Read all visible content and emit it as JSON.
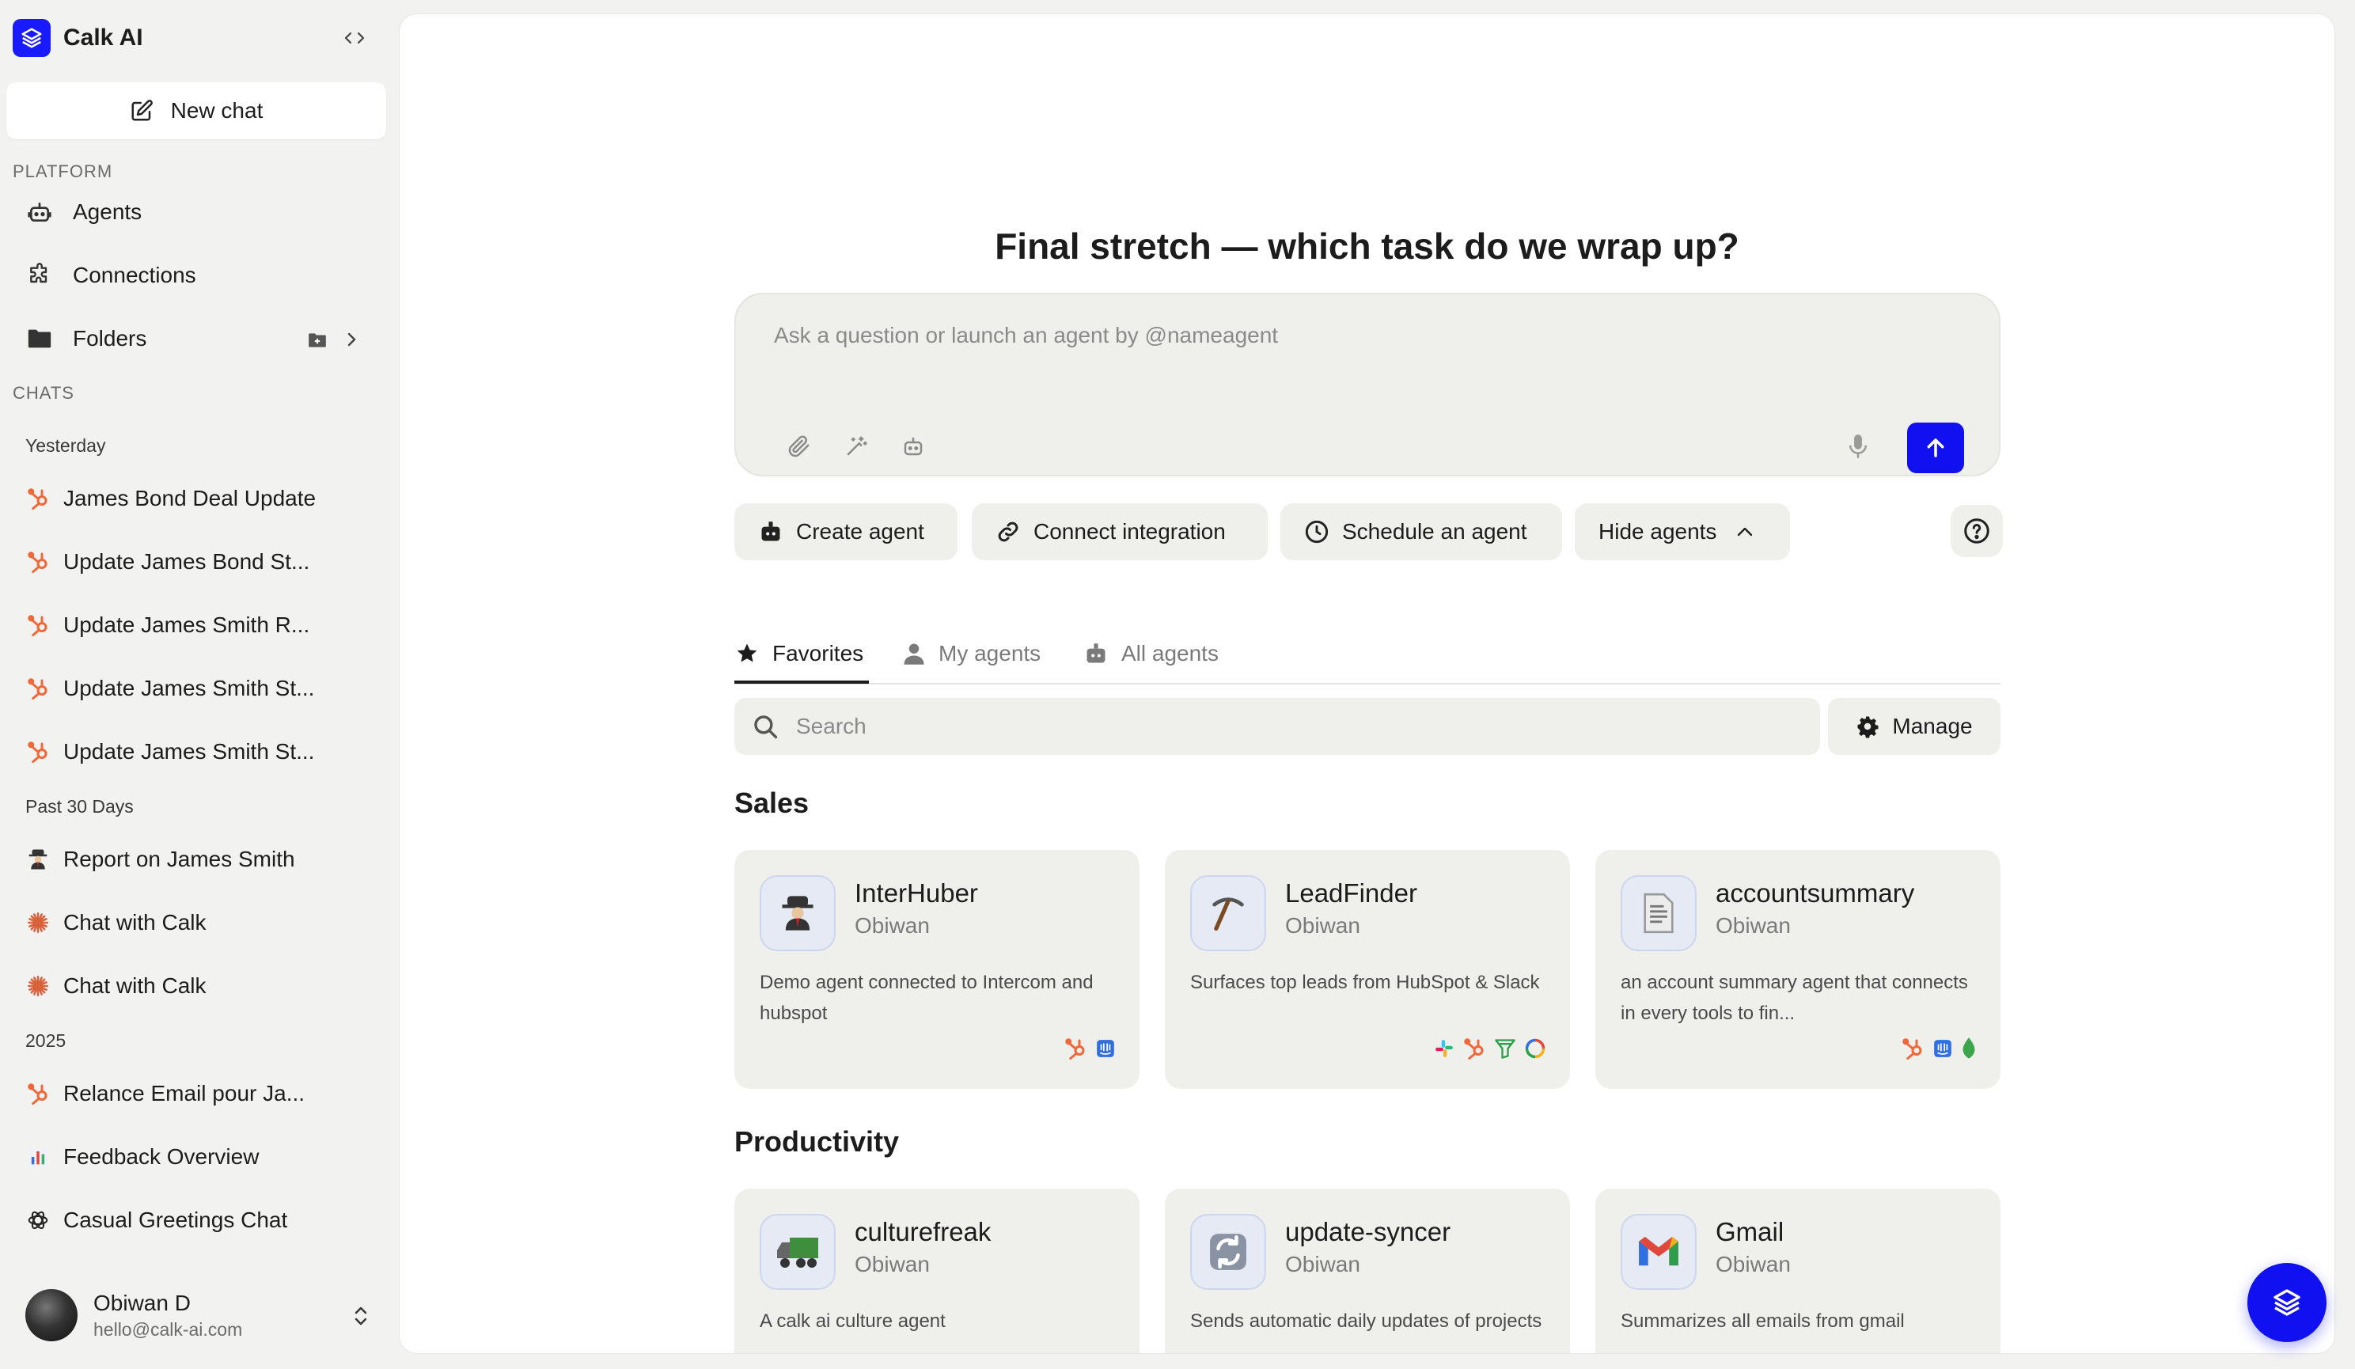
{
  "app": {
    "name": "Calk AI",
    "brand_color": "#1a1aff"
  },
  "sidebar": {
    "new_chat": "New chat",
    "platform_label": "PLATFORM",
    "platform_items": [
      {
        "label": "Agents",
        "icon": "robot-icon"
      },
      {
        "label": "Connections",
        "icon": "puzzle-icon"
      },
      {
        "label": "Folders",
        "icon": "folder-icon"
      }
    ],
    "chats_label": "CHATS",
    "groups": [
      {
        "label": "Yesterday",
        "chats": [
          {
            "label": "James Bond Deal Update",
            "icon": "hubspot-icon"
          },
          {
            "label": "Update James Bond St...",
            "icon": "hubspot-icon"
          },
          {
            "label": "Update James Smith R...",
            "icon": "hubspot-icon"
          },
          {
            "label": "Update James Smith St...",
            "icon": "hubspot-icon"
          },
          {
            "label": "Update James Smith St...",
            "icon": "hubspot-icon"
          }
        ]
      },
      {
        "label": "Past 30 Days",
        "chats": [
          {
            "label": "Report on James Smith",
            "icon": "spy-icon"
          },
          {
            "label": "Chat with Calk",
            "icon": "claude-icon"
          },
          {
            "label": "Chat with Calk",
            "icon": "claude-icon"
          }
        ]
      },
      {
        "label": "2025",
        "chats": [
          {
            "label": "Relance Email pour Ja...",
            "icon": "hubspot-icon"
          },
          {
            "label": "Feedback Overview",
            "icon": "bar-chart-icon"
          },
          {
            "label": "Casual Greetings Chat",
            "icon": "openai-icon"
          }
        ]
      }
    ],
    "user": {
      "name": "Obiwan D",
      "email": "hello@calk-ai.com"
    }
  },
  "main": {
    "headline": "Final stretch — which task do we wrap up?",
    "prompt_placeholder": "Ask a question or launch an agent by @nameagent",
    "chips": [
      "Create agent",
      "Connect integration",
      "Schedule an agent",
      "Hide agents"
    ],
    "tabs": [
      "Favorites",
      "My agents",
      "All agents"
    ],
    "active_tab": "Favorites",
    "search_placeholder": "Search",
    "manage_label": "Manage",
    "categories": [
      {
        "name": "Sales",
        "agents": [
          {
            "title": "InterHuber",
            "owner": "Obiwan",
            "desc": "Demo agent connected to Intercom and hubspot",
            "icon": "spy-icon",
            "tools": [
              "hubspot-icon",
              "intercom-icon"
            ]
          },
          {
            "title": "LeadFinder",
            "owner": "Obiwan",
            "desc": "Surfaces top leads from HubSpot & Slack",
            "icon": "pickaxe-icon",
            "tools": [
              "slack-icon",
              "hubspot-icon",
              "funnel-icon",
              "loop-icon"
            ]
          },
          {
            "title": "accountsummary",
            "owner": "Obiwan",
            "desc": "an account summary agent that connects in every tools to fin...",
            "icon": "document-icon",
            "tools": [
              "hubspot-icon",
              "intercom-icon",
              "mongodb-icon"
            ]
          }
        ]
      },
      {
        "name": "Productivity",
        "agents": [
          {
            "title": "culturefreak",
            "owner": "Obiwan",
            "desc": "A calk ai culture agent",
            "icon": "truck-icon",
            "tools": []
          },
          {
            "title": "update-syncer",
            "owner": "Obiwan",
            "desc": "Sends automatic daily updates of projects",
            "icon": "sync-icon",
            "tools": []
          },
          {
            "title": "Gmail",
            "owner": "Obiwan",
            "desc": "Summarizes all emails from gmail",
            "icon": "gmail-icon",
            "tools": []
          }
        ]
      }
    ]
  }
}
